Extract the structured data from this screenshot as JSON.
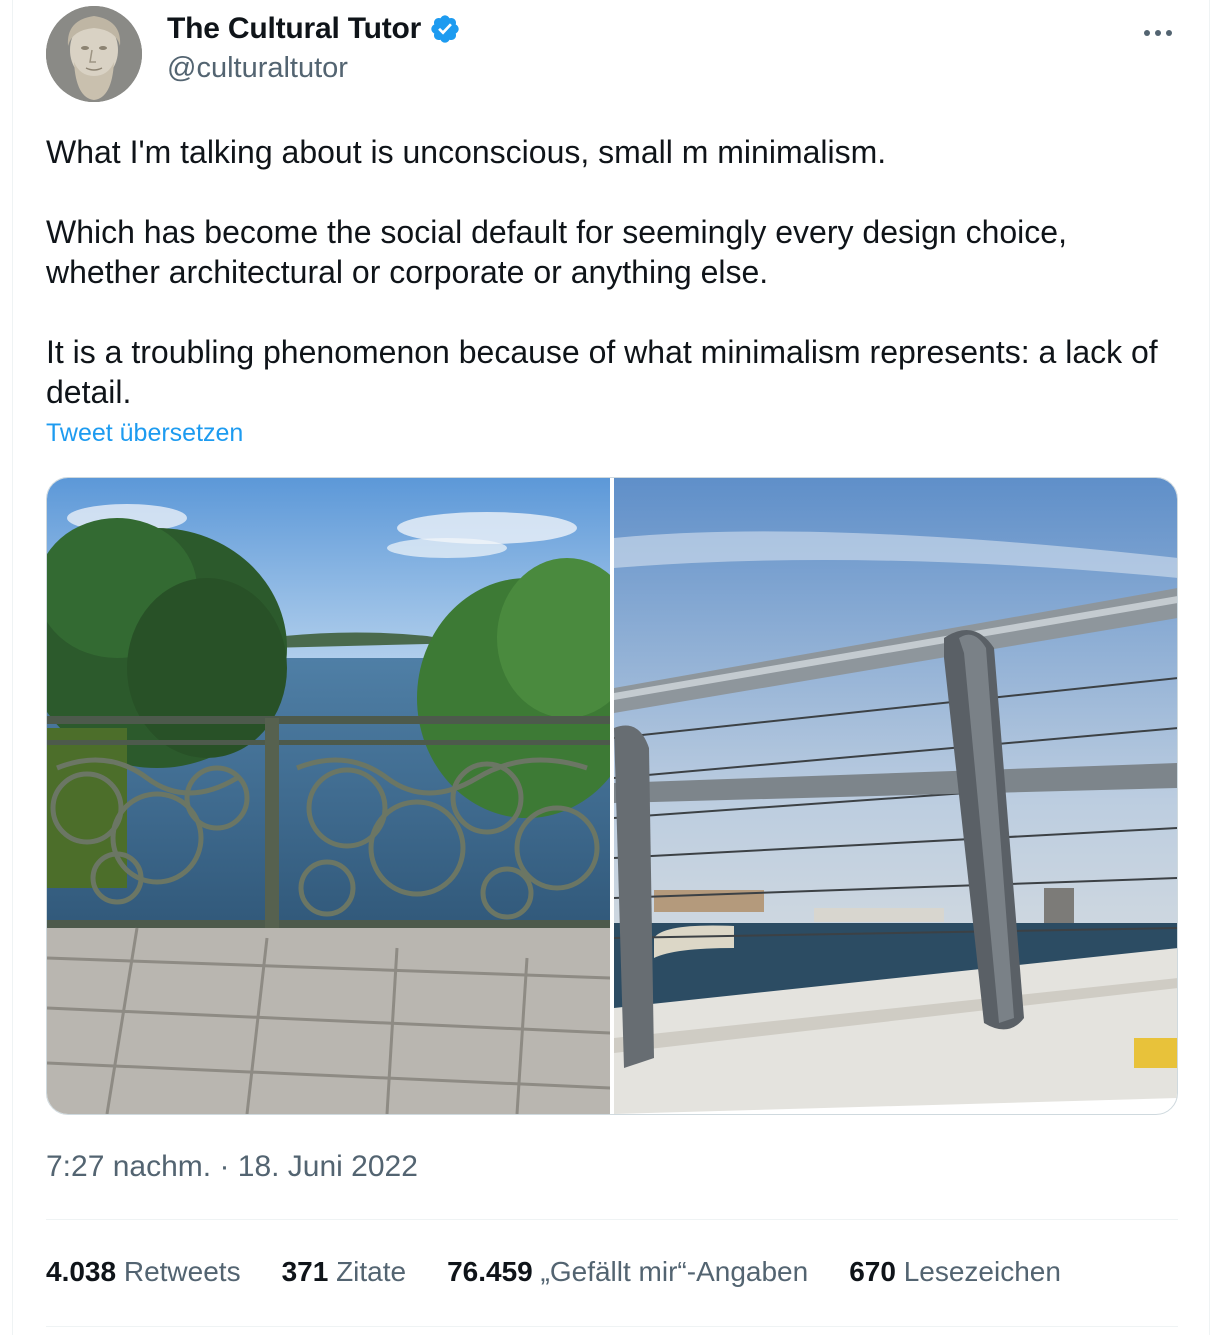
{
  "author": {
    "display_name": "The Cultural Tutor",
    "handle": "@culturaltutor",
    "avatar_icon": "marble-bust-avatar",
    "verified_icon": "verified-badge-icon",
    "verified_color": "#1d9bf0"
  },
  "tweet": {
    "paragraphs": [
      "What I'm talking about is unconscious, small m minimalism.",
      "Which has become the social default for seemingly every design choice, whether architectural or corporate or anything else.",
      "It is a troubling phenomenon because of what minimalism represents: a lack of detail."
    ],
    "translate_label": "Tweet übersetzen"
  },
  "timestamp": "7:27 nachm. · 18. Juni 2022",
  "stats": [
    {
      "value": "4.038",
      "label": "Retweets"
    },
    {
      "value": "371",
      "label": "Zitate"
    },
    {
      "value": "76.459",
      "label": "„Gefällt mir“-Angaben"
    },
    {
      "value": "670",
      "label": "Lesezeichen"
    }
  ],
  "colors": {
    "text": "#0f1419",
    "secondary": "#536471",
    "link": "#1d9bf0",
    "border": "#cfd9de"
  }
}
